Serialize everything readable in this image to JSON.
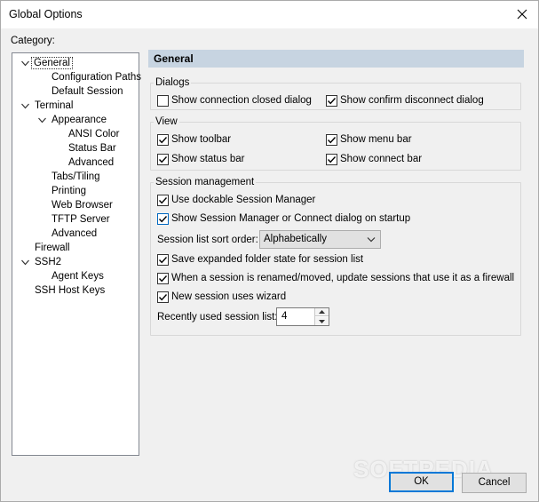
{
  "window": {
    "title": "Global Options"
  },
  "category_label": "Category:",
  "tree": [
    {
      "label": "General",
      "level": 0,
      "selected": true,
      "expanded": true
    },
    {
      "label": "Configuration Paths",
      "level": 1
    },
    {
      "label": "Default Session",
      "level": 1
    },
    {
      "label": "Terminal",
      "level": 0,
      "expanded": true
    },
    {
      "label": "Appearance",
      "level": 1,
      "expanded": true
    },
    {
      "label": "ANSI Color",
      "level": 2
    },
    {
      "label": "Status Bar",
      "level": 2
    },
    {
      "label": "Advanced",
      "level": 2
    },
    {
      "label": "Tabs/Tiling",
      "level": 1
    },
    {
      "label": "Printing",
      "level": 1
    },
    {
      "label": "Web Browser",
      "level": 1
    },
    {
      "label": "TFTP Server",
      "level": 1
    },
    {
      "label": "Advanced",
      "level": 1
    },
    {
      "label": "Firewall",
      "level": 0
    },
    {
      "label": "SSH2",
      "level": 0,
      "expanded": true
    },
    {
      "label": "Agent Keys",
      "level": 1
    },
    {
      "label": "SSH Host Keys",
      "level": 0
    }
  ],
  "panel": {
    "header": "General",
    "dialogs": {
      "title": "Dialogs",
      "show_connection_closed": {
        "label": "Show connection closed dialog",
        "checked": false
      },
      "show_confirm_disconnect": {
        "label": "Show confirm disconnect dialog",
        "checked": true
      }
    },
    "view": {
      "title": "View",
      "show_toolbar": {
        "label": "Show toolbar",
        "checked": true
      },
      "show_menu_bar": {
        "label": "Show menu bar",
        "checked": true
      },
      "show_status_bar": {
        "label": "Show status bar",
        "checked": true
      },
      "show_connect_bar": {
        "label": "Show connect bar",
        "checked": true
      }
    },
    "session_mgmt": {
      "title": "Session management",
      "use_dockable": {
        "label": "Use dockable Session Manager",
        "checked": true
      },
      "show_on_startup": {
        "label": "Show Session Manager or Connect dialog on startup",
        "checked": true
      },
      "sort_order_label": "Session list sort order:",
      "sort_order_value": "Alphabetically",
      "save_expanded": {
        "label": "Save expanded folder state for session list",
        "checked": true
      },
      "update_firewall": {
        "label": "When a session is renamed/moved, update sessions that use it as a firewall",
        "checked": true
      },
      "new_session_wizard": {
        "label": "New session uses wizard",
        "checked": true
      },
      "recent_label": "Recently used session list:",
      "recent_value": "4"
    }
  },
  "buttons": {
    "ok": "OK",
    "cancel": "Cancel"
  },
  "watermark": "SOFTPEDIA",
  "colors": {
    "header_bg": "#c7d4e1",
    "default_button_border": "#0078d7"
  }
}
